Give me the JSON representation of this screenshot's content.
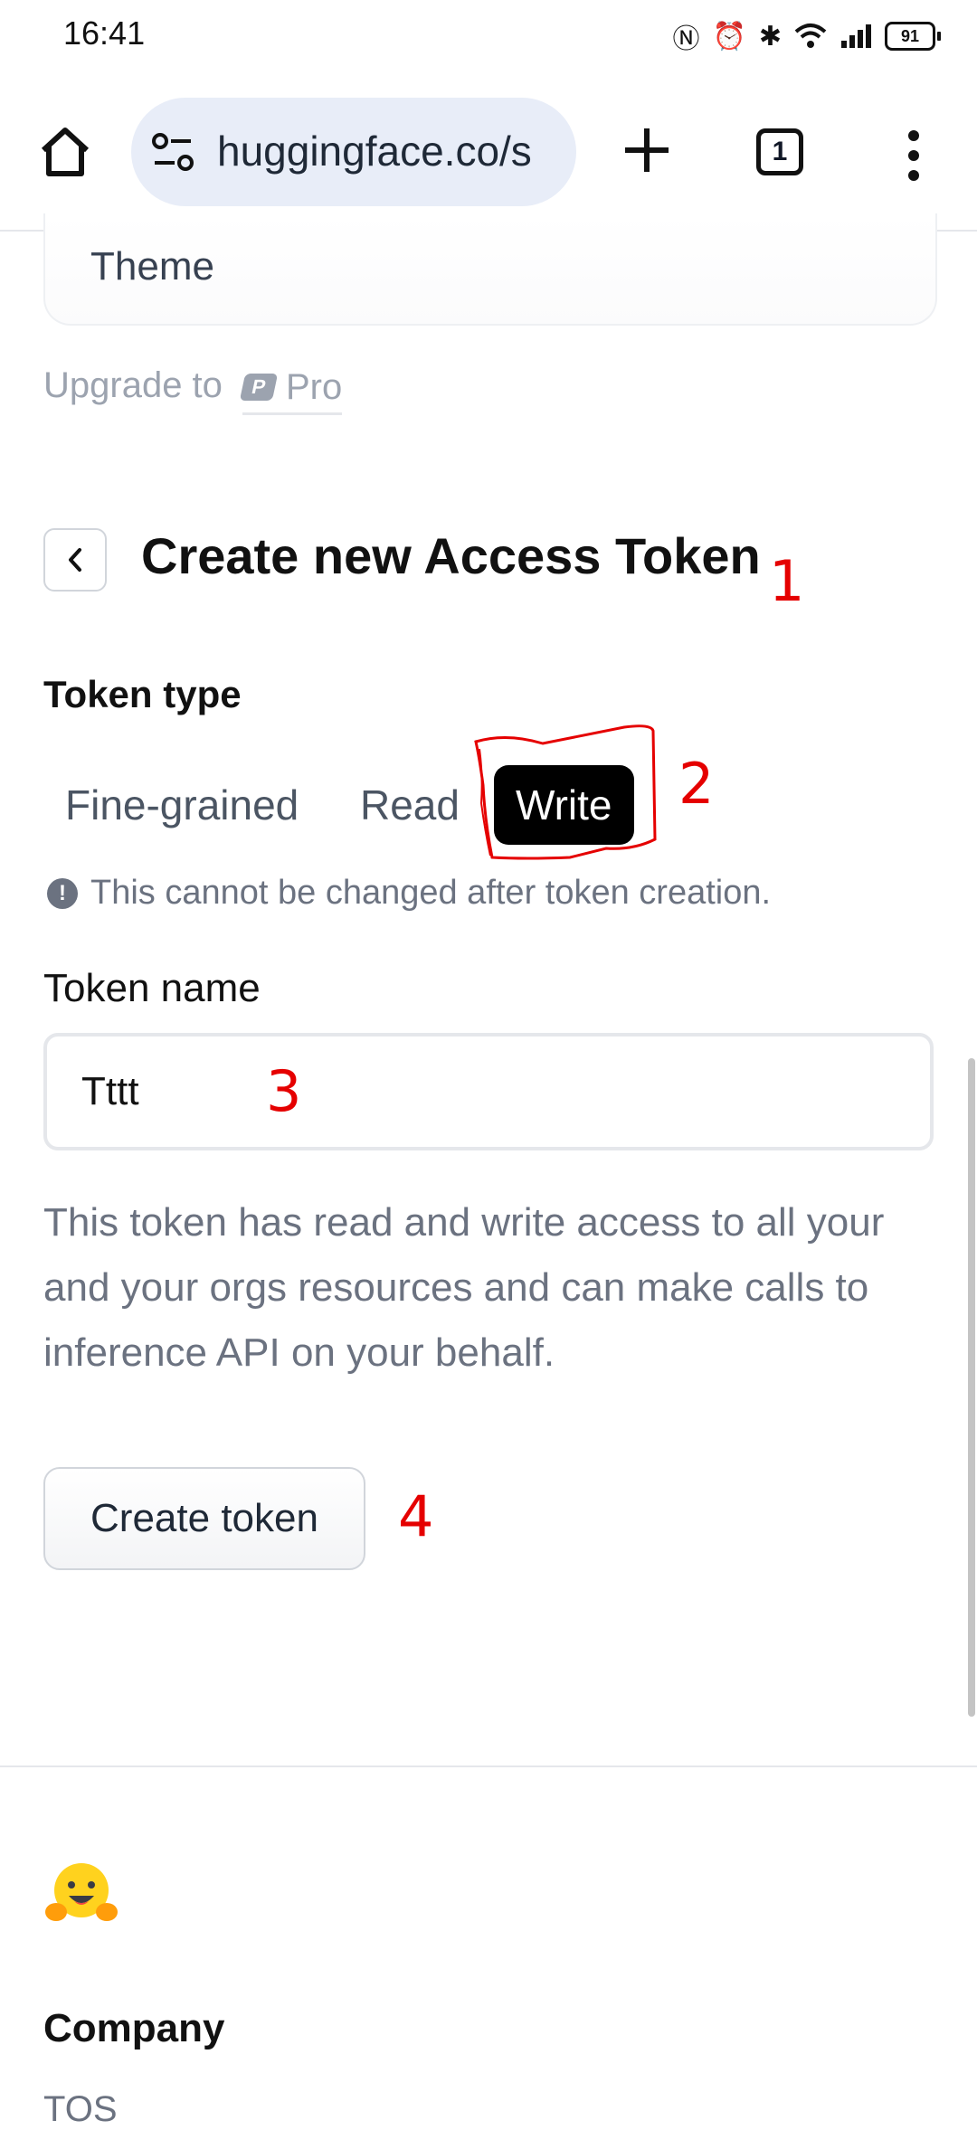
{
  "status_bar": {
    "time": "16:41",
    "battery": "91"
  },
  "browser": {
    "url": "huggingface.co/s",
    "tab_count": "1"
  },
  "settings": {
    "theme_label": "Theme",
    "upgrade_text": "Upgrade to",
    "pro_label": "Pro"
  },
  "form": {
    "title": "Create new Access Token",
    "token_type_label": "Token type",
    "token_type_options": [
      "Fine-grained",
      "Read",
      "Write"
    ],
    "token_type_selected": "Write",
    "warning": "This cannot be changed after token creation.",
    "token_name_label": "Token name",
    "token_name_value": "Tttt",
    "description": "This token has read and write access to all your and your orgs resources and can make calls to inference API on your behalf.",
    "create_button": "Create token"
  },
  "footer": {
    "company_heading": "Company",
    "tos_link": "TOS"
  },
  "annotations": [
    "1",
    "2",
    "3",
    "4"
  ],
  "colors": {
    "annotation": "#e50000",
    "selected_bg": "#000000",
    "url_pill_bg": "#e8edf8"
  },
  "icons": [
    "home-icon",
    "site-info-icon",
    "plus-icon",
    "tabs-icon",
    "more-vert-icon",
    "back-chevron-icon",
    "warning-icon",
    "hugging-face-emoji"
  ]
}
